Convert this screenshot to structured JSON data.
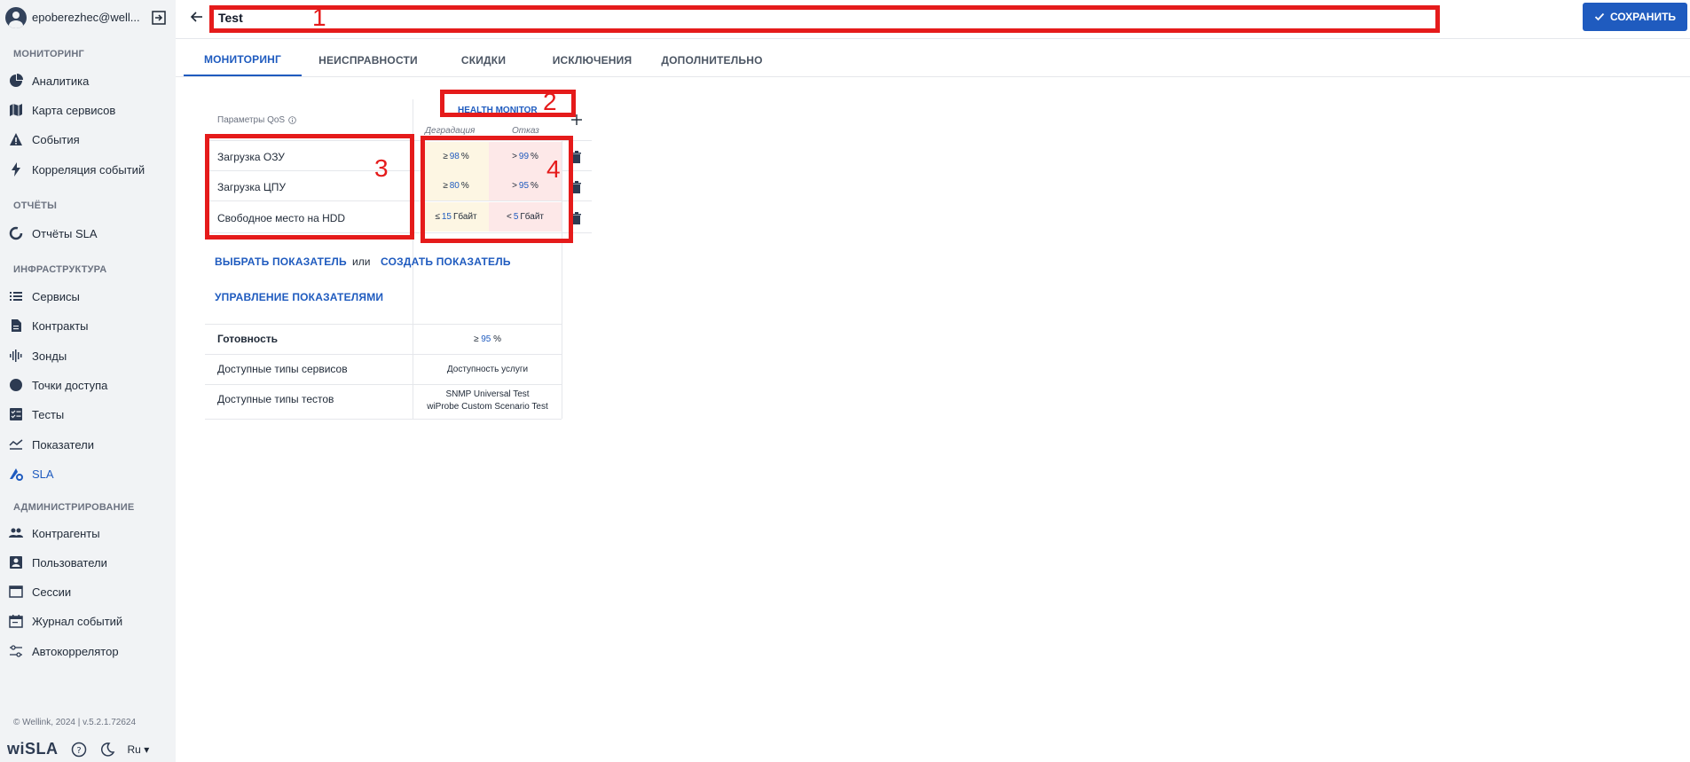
{
  "user": {
    "name": "epoberezhec@well..."
  },
  "sidebar": {
    "sections": [
      {
        "title": "МОНИТОРИНГ"
      },
      {
        "title": "ОТЧЁТЫ"
      },
      {
        "title": "ИНФРАСТРУКТУРА"
      },
      {
        "title": "АДМИНИСТРИРОВАНИЕ"
      }
    ],
    "items": [
      {
        "label": "Аналитика"
      },
      {
        "label": "Карта сервисов"
      },
      {
        "label": "События"
      },
      {
        "label": "Корреляция событий"
      },
      {
        "label": "Отчёты SLA"
      },
      {
        "label": "Сервисы"
      },
      {
        "label": "Контракты"
      },
      {
        "label": "Зонды"
      },
      {
        "label": "Точки доступа"
      },
      {
        "label": "Тесты"
      },
      {
        "label": "Показатели"
      },
      {
        "label": "SLA"
      },
      {
        "label": "Контрагенты"
      },
      {
        "label": "Пользователи"
      },
      {
        "label": "Сессии"
      },
      {
        "label": "Журнал событий"
      },
      {
        "label": "Автокоррелятор"
      }
    ],
    "footer": {
      "copyright": "© Wellink, 2024 | v.5.2.1.72624",
      "logo": "wiSLA",
      "lang": "Ru"
    }
  },
  "header": {
    "title_value": "Test",
    "save_label": "СОХРАНИТЬ"
  },
  "tabs": [
    {
      "label": "МОНИТОРИНГ"
    },
    {
      "label": "НЕИСПРАВНОСТИ"
    },
    {
      "label": "СКИДКИ"
    },
    {
      "label": "ИСКЛЮЧЕНИЯ"
    },
    {
      "label": "ДОПОЛНИТЕЛЬНО"
    }
  ],
  "qos": {
    "param_header": "Параметры QoS",
    "group_name": "HEALTH MONITOR",
    "col_degradation": "Деградация",
    "col_failure": "Отказ",
    "rows": [
      {
        "label": "Загрузка ОЗУ",
        "deg_op": "≥",
        "deg_val": "98",
        "deg_unit": "%",
        "fail_op": ">",
        "fail_val": "99",
        "fail_unit": "%"
      },
      {
        "label": "Загрузка ЦПУ",
        "deg_op": "≥",
        "deg_val": "80",
        "deg_unit": "%",
        "fail_op": ">",
        "fail_val": "95",
        "fail_unit": "%"
      },
      {
        "label": "Свободное место на HDD",
        "deg_op": "≤",
        "deg_val": "15",
        "deg_unit": "Гбайт",
        "fail_op": "<",
        "fail_val": "5",
        "fail_unit": "Гбайт"
      }
    ],
    "select_link": "ВЫБРАТЬ ПОКАЗАТЕЛЬ",
    "or_text": "или",
    "create_link": "СОЗДАТЬ ПОКАЗАТЕЛЬ",
    "manage_link": "УПРАВЛЕНИЕ ПОКАЗАТЕЛЯМИ",
    "info": [
      {
        "label": "Готовность",
        "op": "≥",
        "val": "95",
        "unit": "%"
      },
      {
        "label": "Доступные типы сервисов",
        "value": "Доступность услуги"
      },
      {
        "label": "Доступные типы тестов",
        "value1": "SNMP Universal Test",
        "value2": "wiProbe Custom Scenario Test"
      }
    ]
  },
  "annotations": [
    "1",
    "2",
    "3",
    "4"
  ],
  "colors": {
    "accent": "#1f5bbf",
    "annotation": "#e51b1b",
    "degradation_bg": "#fdf6e3",
    "failure_bg": "#fde8e8",
    "sidebar_bg": "#f1f3f5"
  }
}
